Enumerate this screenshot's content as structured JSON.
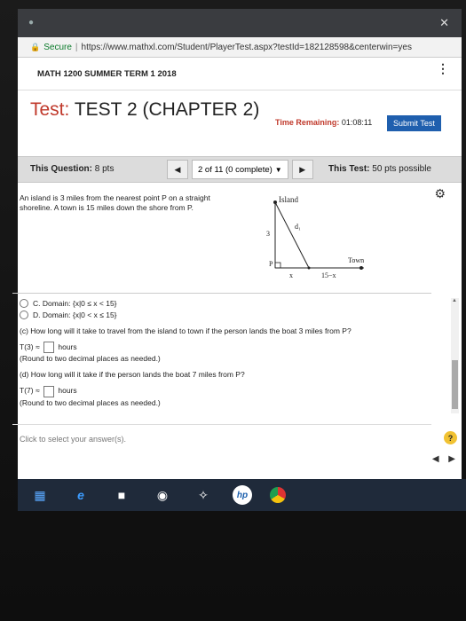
{
  "browser": {
    "secure_label": "Secure",
    "url": "https://www.mathxl.com/Student/PlayerTest.aspx?testId=182128598&centerwin=yes",
    "close_icon": "close-icon"
  },
  "course": {
    "title": "MATH 1200 SUMMER TERM 1 2018"
  },
  "test": {
    "label": "Test:",
    "name": "TEST 2 (CHAPTER 2)",
    "time_label": "Time Remaining:",
    "time_value": "01:08:11",
    "submit_label": "Submit Test"
  },
  "question_bar": {
    "this_question_label": "This Question:",
    "this_question_pts": "8 pts",
    "nav_text": "2 of 11 (0 complete)",
    "this_test_label": "This Test:",
    "this_test_pts": "50 pts possible"
  },
  "problem": {
    "text": "An island is 3 miles from the nearest point P on a straight shoreline. A town is 15 miles down the shore from P."
  },
  "figure": {
    "island_label": "Island",
    "d1_label": "d₁",
    "side_label": "3",
    "p_label": "P",
    "town_label": "Town",
    "x_label": "x",
    "remaining_label": "15−x"
  },
  "answers": {
    "option_c": "C.  Domain: {x|0 ≤ x < 15}",
    "option_d": "D.  Domain: {x|0 < x ≤ 15}",
    "part_c": "(c) How long will it take to travel from the island to town if the person lands the boat 3 miles from P?",
    "t3_prefix": "T(3) ≈",
    "t3_unit": "hours",
    "t3_note": "(Round to two decimal places as needed.)",
    "part_d": "(d) How long will it take if the person lands the boat 7 miles from P?",
    "t7_prefix": "T(7) ≈",
    "t7_unit": "hours",
    "t7_note": "(Round to two decimal places as needed.)"
  },
  "footer": {
    "click_select": "Click to select your answer(s).",
    "help": "?"
  }
}
